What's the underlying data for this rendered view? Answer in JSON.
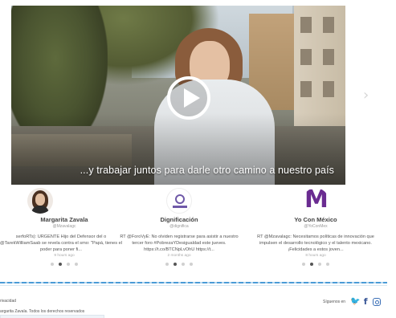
{
  "hero": {
    "caption": "...y trabajar juntos para darle otro camino a nuestro país",
    "next_arrow": "›",
    "play_icon": "play-icon"
  },
  "cards": [
    {
      "name": "Margarita Zavala",
      "handle": "@Mzavalagc",
      "text": "serfoRTs): URGENTE Hijo del Defensor del o @TarekWilliamSaab se revela contra el smo: \"Papá, tienes el poder para poner fi...",
      "time": "9 hours ago",
      "avatar_icon": "portrait-photo",
      "active_dot": 1
    },
    {
      "name": "Dignificación",
      "handle": "@dignifica",
      "text": "RT @ForoVyE: No olviden registrarse para asistir a nuestro tercer foro #PobrezaYDesigualdad este jueves. https://t.co/BTCNpLvOhU https://t...",
      "time": "2 months ago",
      "avatar_icon": "dignificacion-logo",
      "active_dot": 1
    },
    {
      "name": "Yo Con México",
      "handle": "@YoConMex",
      "text": "RT @Mzavalagc: Necesitamos políticas de innovación que impulsen el desarrollo tecnológico y el talento mexicano. ¡Felicidades a estos joven...",
      "time": "8 hours ago",
      "avatar_icon": "m-logo",
      "active_dot": 1
    }
  ],
  "footer": {
    "privacy": "rivacidad",
    "copyright": "argarita Zavala. Todos los derechos reservados",
    "follow_label": "Síguenos en",
    "social": [
      "twitter-icon",
      "facebook-icon",
      "instagram-icon"
    ],
    "colors": {
      "accent_line": "#4a9bd6",
      "twitter": "#1da1f2",
      "facebook": "#3b5998",
      "instagram": "#3b6fb6"
    }
  }
}
